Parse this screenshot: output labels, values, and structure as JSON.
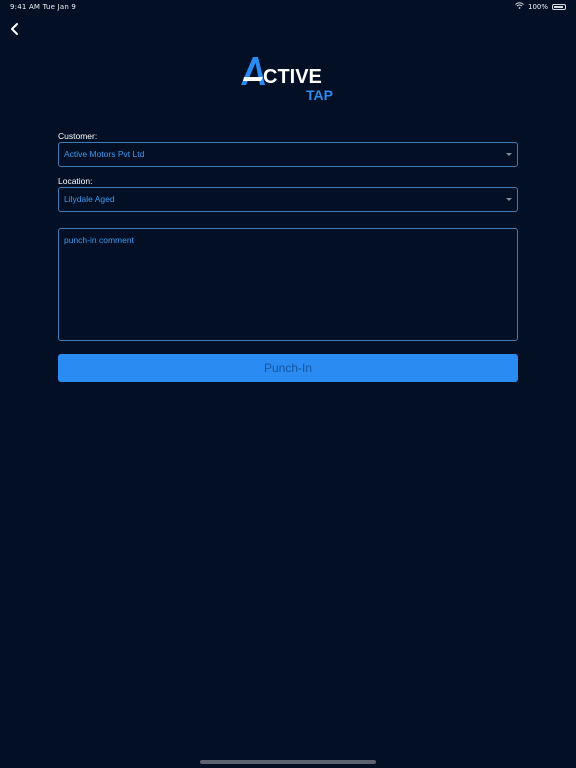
{
  "status_bar": {
    "time_date": "9:41 AM  Tue Jan 9",
    "battery": "100%"
  },
  "header": {
    "back_icon": "chevron-left-icon"
  },
  "logo": {
    "text_top": "CTIVE",
    "letter": "A",
    "text_bottom": "TAP",
    "accent": "#2a8bf2"
  },
  "form": {
    "customer_label": "Customer:",
    "customer_value": "Active Motors Pvt Ltd",
    "location_label": "Location:",
    "location_value": "Lilydale Aged",
    "comment_placeholder": "punch-in comment",
    "submit_label": "Punch-In"
  },
  "colors": {
    "background": "#020f24",
    "accent": "#2a8bf2",
    "field_border": "#3f7bb5",
    "field_text": "#3b9cf0"
  }
}
